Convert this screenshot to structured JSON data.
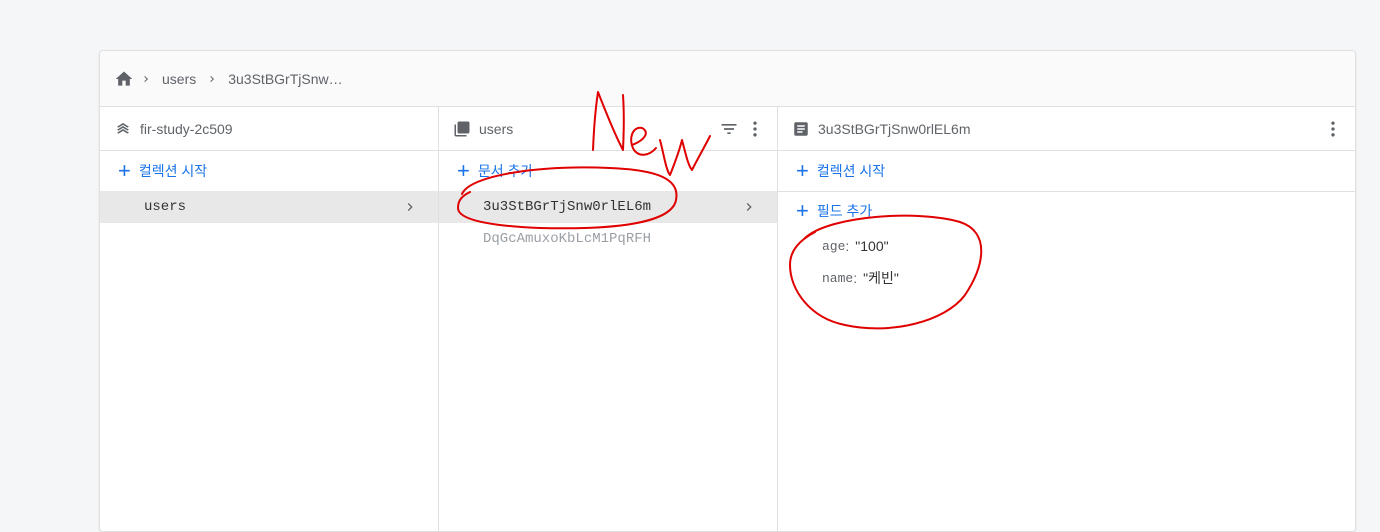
{
  "breadcrumb": {
    "collection": "users",
    "document": "3u3StBGrTjSnw…"
  },
  "columns": {
    "project": {
      "title": "fir-study-2c509",
      "add_label": "컬렉션 시작",
      "items": [
        {
          "label": "users"
        }
      ]
    },
    "collection": {
      "title": "users",
      "add_label": "문서 추가",
      "items": [
        {
          "label": "3u3StBGrTjSnw0rlEL6m"
        },
        {
          "label": "DqGcAmuxoKbLcM1PqRFH"
        }
      ]
    },
    "document": {
      "title": "3u3StBGrTjSnw0rlEL6m",
      "add_collection_label": "컬렉션 시작",
      "add_field_label": "필드 추가",
      "fields": [
        {
          "key": "age",
          "value": "\"100\""
        },
        {
          "key": "name",
          "value": "\"케빈\""
        }
      ]
    }
  },
  "annotation": {
    "text": "New",
    "color": "#e00000"
  },
  "colors": {
    "accent": "#1a73e8",
    "selected_bg": "#e8e8e8"
  }
}
